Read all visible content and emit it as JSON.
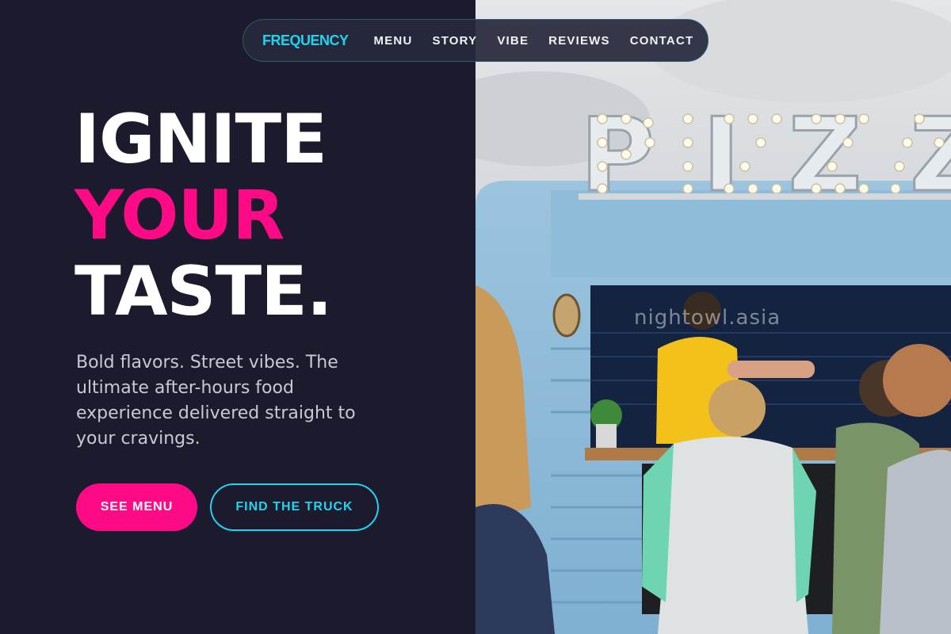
{
  "nav": {
    "logo": "FREQUENCY",
    "links": [
      "MENU",
      "STORY",
      "VIBE",
      "REVIEWS",
      "CONTACT"
    ]
  },
  "hero": {
    "headline": [
      "IGNITE",
      "YOUR",
      "TASTE."
    ],
    "tagline": "Bold flavors. Street vibes. The ultimate after-hours food experience delivered straight to your cravings.",
    "buttons": {
      "primary": "SEE MENU",
      "secondary": "FIND THE TRUCK"
    }
  },
  "photo": {
    "sign": "PIZZA",
    "watermark": "nightowl.asia"
  },
  "colors": {
    "background": "#1c1b2e",
    "accent_pink": "#ff0a86",
    "accent_cyan": "#22d3ee"
  }
}
